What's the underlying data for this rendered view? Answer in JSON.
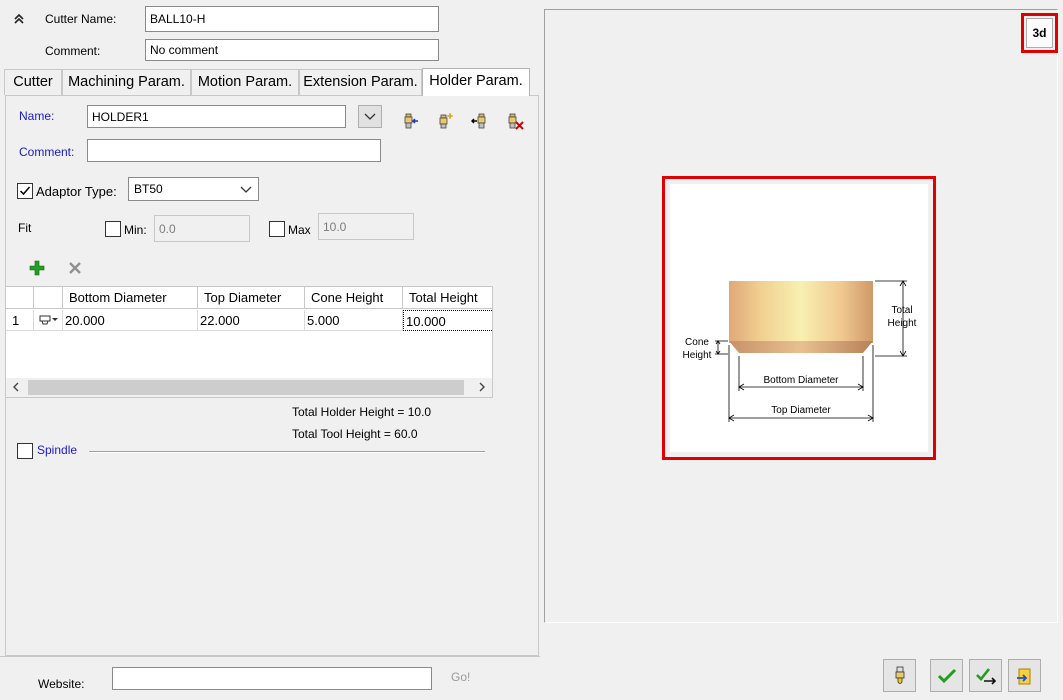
{
  "header": {
    "cutter_name_label": "Cutter Name:",
    "cutter_name_value": "BALL10-H",
    "comment_label": "Comment:",
    "comment_value": "No comment",
    "collapse_icon": "double-chevron-up-icon"
  },
  "tabs": [
    {
      "label": "Cutter",
      "active": false
    },
    {
      "label": "Machining Param.",
      "active": false
    },
    {
      "label": "Motion Param.",
      "active": false
    },
    {
      "label": "Extension Param.",
      "active": false
    },
    {
      "label": "Holder Param.",
      "active": true
    }
  ],
  "holder": {
    "name_label": "Name:",
    "name_value": "HOLDER1",
    "comment_label": "Comment:",
    "comment_value": "",
    "adaptor_type_label": "Adaptor Type:",
    "adaptor_type_checked": true,
    "adaptor_type_value": "BT50",
    "fit_label": "Fit",
    "min_label": "Min:",
    "min_value": "0.0",
    "max_label": "Max",
    "max_value": "10.0",
    "total_holder_height": "Total Holder Height = 10.0",
    "total_tool_height": "Total Tool Height = 60.0",
    "spindle_label": "Spindle"
  },
  "grid": {
    "columns": [
      "",
      "",
      "Bottom Diameter",
      "Top Diameter",
      "Cone Height",
      "Total Height"
    ],
    "rows": [
      {
        "index": "1",
        "bottom_diameter": "20.000",
        "top_diameter": "22.000",
        "cone_height": "5.000",
        "total_height": "10.000"
      }
    ]
  },
  "preview": {
    "button_3d": "3d",
    "diagram_labels": {
      "total": "Total",
      "height": "Height",
      "cone": "Cone",
      "cone_height": "Height",
      "bottom_diameter": "Bottom Diameter",
      "top_diameter": "Top Diameter"
    }
  },
  "footer": {
    "website_label": "Website:",
    "website_value": "",
    "go_label": "Go!"
  },
  "colors": {
    "highlight": "#e00000",
    "label_blue": "#1a1acc",
    "holder_light": "#f8f0b0",
    "holder_dark": "#e0a878"
  }
}
